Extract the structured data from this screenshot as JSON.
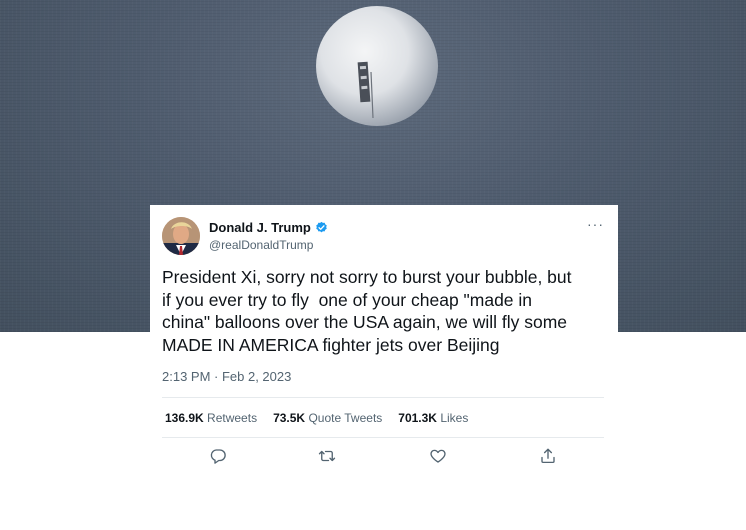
{
  "background": {
    "sky_color": "#4f5c6e",
    "object": "balloon"
  },
  "tweet": {
    "author": {
      "name": "Donald J. Trump",
      "handle": "@realDonaldTrump",
      "verified_icon": "verified-badge-icon",
      "avatar_icon": "avatar"
    },
    "more_label": "···",
    "text": "President Xi, sorry not sorry to burst your bubble, but\nif you ever try to fly  one of your cheap \"made in\nchina\" balloons over the USA again, we will fly some\nMADE IN AMERICA fighter jets over Beijing",
    "timestamp": "2:13 PM · Feb 2, 2023",
    "stats": {
      "retweets_count": "136.9K",
      "retweets_label": "Retweets",
      "quotes_count": "73.5K",
      "quotes_label": "Quote Tweets",
      "likes_count": "701.3K",
      "likes_label": "Likes"
    },
    "actions": [
      "reply-icon",
      "retweet-icon",
      "like-icon",
      "share-icon"
    ],
    "colors": {
      "text": "#0f1419",
      "secondary": "#536471",
      "verified": "#1d9bf0",
      "divider": "#e6eaed"
    }
  }
}
